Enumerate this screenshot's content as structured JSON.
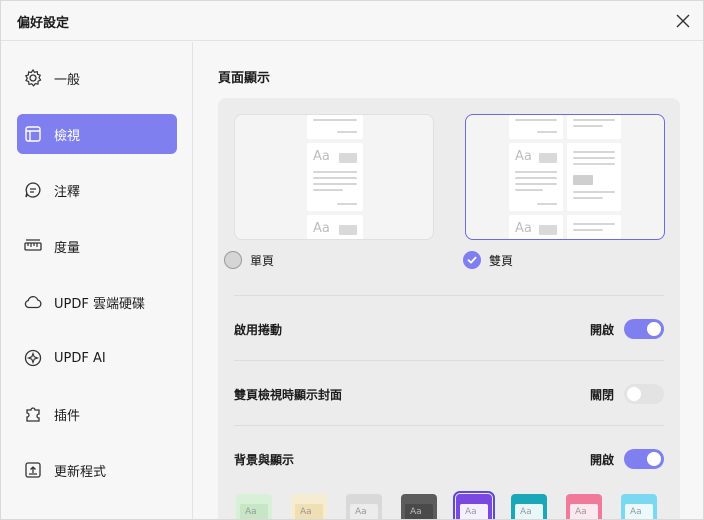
{
  "window": {
    "title": "偏好設定"
  },
  "sidebar": {
    "items": [
      {
        "label": "一般",
        "icon": "gear-icon",
        "active": false
      },
      {
        "label": "檢視",
        "icon": "layout-icon",
        "active": true
      },
      {
        "label": "注釋",
        "icon": "comment-icon",
        "active": false
      },
      {
        "label": "度量",
        "icon": "ruler-icon",
        "active": false
      },
      {
        "label": "UPDF 雲端硬碟",
        "icon": "cloud-icon",
        "active": false
      },
      {
        "label": "UPDF AI",
        "icon": "ai-sparkle-icon",
        "active": false
      },
      {
        "label": "插件",
        "icon": "plugin-icon",
        "active": false
      },
      {
        "label": "更新程式",
        "icon": "update-icon",
        "active": false
      }
    ]
  },
  "main": {
    "section_title": "頁面顯示",
    "layouts": [
      {
        "label": "單頁",
        "selected": false
      },
      {
        "label": "雙頁",
        "selected": true
      }
    ],
    "settings": [
      {
        "name": "啟用捲動",
        "state": "開啟",
        "on": true
      },
      {
        "name": "雙頁檢視時顯示封面",
        "state": "關閉",
        "on": false
      },
      {
        "name": "背景與顯示",
        "state": "開啟",
        "on": true
      }
    ],
    "themes": [
      {
        "label": "Aa",
        "bg": "#d8f0d8",
        "inner": "#c6e6c6",
        "selected": false
      },
      {
        "label": "Aa",
        "bg": "#f6ecd2",
        "inner": "#f0dfb5",
        "selected": false
      },
      {
        "label": "Aa",
        "bg": "#d9d9d9",
        "inner": "#ececec",
        "selected": false
      },
      {
        "label": "Aa",
        "bg": "#5c5c5c",
        "inner": "#4a4a4a",
        "selected": false
      },
      {
        "label": "Aa",
        "bg": "#7a4ae0",
        "inner": "#f4f0ff",
        "selected": true
      },
      {
        "label": "Aa",
        "bg": "#1aa8b8",
        "inner": "#e8f8fa",
        "selected": false
      },
      {
        "label": "Aa",
        "bg": "#f07a9a",
        "inner": "#fde8ef",
        "selected": false
      },
      {
        "label": "Aa",
        "bg": "#7ad8f0",
        "inner": "#eafaff",
        "selected": false
      }
    ]
  },
  "colors": {
    "accent": "#7f7ff0"
  }
}
